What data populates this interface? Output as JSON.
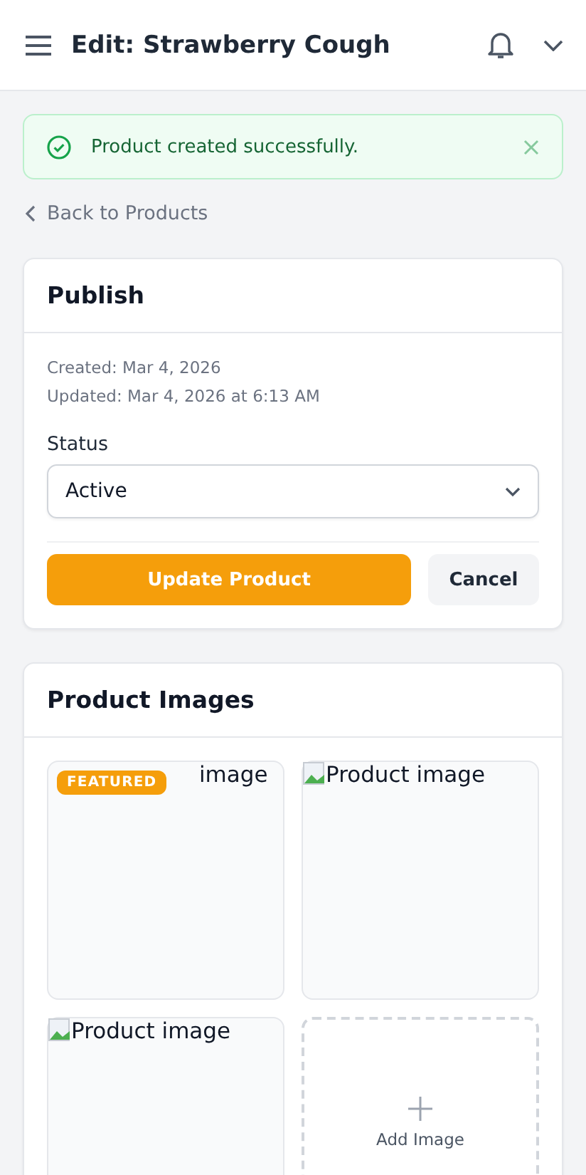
{
  "header": {
    "title": "Edit: Strawberry Cough"
  },
  "alert": {
    "message": "Product created successfully."
  },
  "back_link": "Back to Products",
  "publish": {
    "title": "Publish",
    "created": "Created: Mar 4, 2026",
    "updated": "Updated: Mar 4, 2026 at 6:13 AM",
    "status_label": "Status",
    "status_value": "Active",
    "primary_button": "Update Product",
    "secondary_button": "Cancel"
  },
  "images": {
    "title": "Product Images",
    "badge": "FEATURED",
    "items": [
      {
        "alt_text": "image",
        "featured": true
      },
      {
        "alt_text": "Product image",
        "featured": false
      },
      {
        "alt_text": "Product image",
        "featured": false
      }
    ],
    "add_label": "Add Image"
  }
}
